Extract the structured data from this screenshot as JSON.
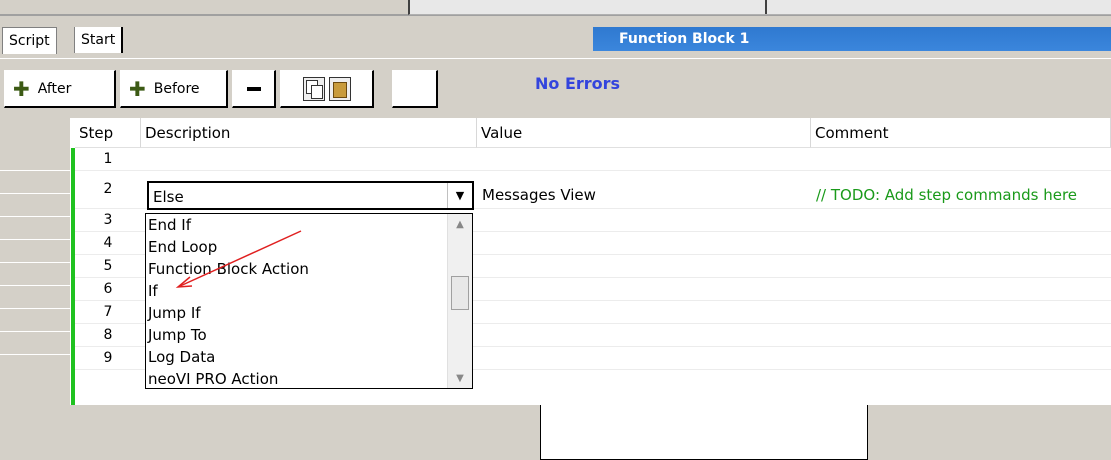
{
  "tabs": [
    {
      "label": "Script"
    },
    {
      "label": "Start"
    }
  ],
  "panel_title": "Function Block 1",
  "toolbar": {
    "after_label": "After",
    "before_label": "Before",
    "status": "No Errors"
  },
  "grid": {
    "columns": [
      "Step",
      "Description",
      "Value",
      "Comment"
    ],
    "rows": [
      {
        "step": "1"
      },
      {
        "step": "2",
        "description": "Else",
        "value": "Messages View",
        "comment": "// TODO: Add step commands here"
      },
      {
        "step": "3"
      },
      {
        "step": "4"
      },
      {
        "step": "5"
      },
      {
        "step": "6"
      },
      {
        "step": "7"
      },
      {
        "step": "8"
      },
      {
        "step": "9"
      }
    ]
  },
  "dropdown": {
    "selected": "Else",
    "options": [
      "End If",
      "End Loop",
      "Function Block Action",
      "If",
      "Jump If",
      "Jump To",
      "Log Data",
      "neoVI PRO Action"
    ]
  },
  "colors": {
    "title_bg": "#3b86dc",
    "status": "#3344dd",
    "comment": "#1a9a1a",
    "step_bar": "#1fc21f",
    "annotation_arrow": "#e02020"
  }
}
